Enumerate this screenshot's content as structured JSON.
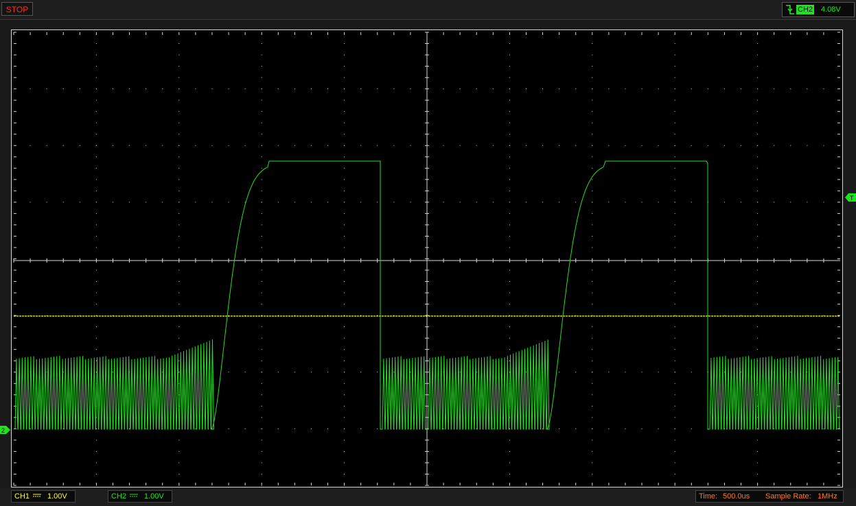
{
  "status": {
    "run_state": "STOP"
  },
  "trigger": {
    "icon": "falling-edge-trigger-icon",
    "channel": "CH2",
    "level": "4.08V"
  },
  "markers": {
    "trigger_level": "T",
    "ch2_ground": "2"
  },
  "channels": [
    {
      "name": "CH1",
      "coupling_icon": "dc-coupling-icon",
      "scale": "1.00V",
      "color": "#ffff2a"
    },
    {
      "name": "CH2",
      "coupling_icon": "dc-coupling-icon",
      "scale": "1.00V",
      "color": "#21e221"
    }
  ],
  "timebase": {
    "label": "Time:",
    "value": "500.0us"
  },
  "sample_rate": {
    "label": "Sample Rate:",
    "value": "1MHz"
  },
  "colors": {
    "ch1": "#ffff2a",
    "ch2": "#21e221",
    "stop": "#ff2a2a",
    "info": "#ff7a1e",
    "grid": "#d8d8d8"
  }
}
